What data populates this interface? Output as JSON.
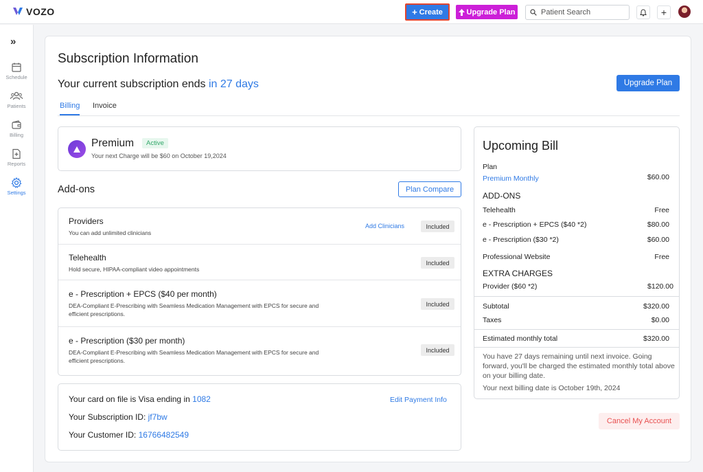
{
  "header": {
    "logo": "VOZO",
    "create_label": "Create",
    "upgrade_label": "Upgrade Plan",
    "search_placeholder": "Patient Search"
  },
  "sidebar": {
    "items": [
      {
        "label": "Schedule",
        "icon": "calendar-icon"
      },
      {
        "label": "Patients",
        "icon": "users-icon"
      },
      {
        "label": "Billing",
        "icon": "wallet-icon"
      },
      {
        "label": "Reports",
        "icon": "report-icon"
      },
      {
        "label": "Settings",
        "icon": "gear-icon"
      }
    ]
  },
  "page": {
    "title": "Subscription Information",
    "subscription_prefix": "Your current subscription ends",
    "subscription_days": "in 27 days",
    "upgrade_button": "Upgrade Plan",
    "tabs": [
      "Billing",
      "Invoice"
    ]
  },
  "plan": {
    "name": "Premium",
    "status": "Active",
    "next_charge": "Your next Charge will be $60 on October 19,2024"
  },
  "addons": {
    "title": "Add-ons",
    "compare_button": "Plan Compare",
    "items": [
      {
        "name": "Providers",
        "desc": "You can add unlimited clinicians",
        "action": "Add Clinicians",
        "badge": "Included"
      },
      {
        "name": "Telehealth",
        "desc": "Hold secure, HIPAA-compliant video appointments",
        "badge": "Included"
      },
      {
        "name": "e - Prescription + EPCS ($40 per month)",
        "desc": "DEA-Compliant E-Prescribing with Seamless Medication Management with EPCS for secure and efficient prescriptions.",
        "badge": "Included"
      },
      {
        "name": "e - Prescription ($30 per month)",
        "desc": "DEA-Compliant E-Prescribing with Seamless Medication Management with EPCS for secure and efficient prescriptions.",
        "badge": "Included"
      }
    ]
  },
  "payment": {
    "card_prefix": "Your card on file is Visa ending in",
    "card_last4": "1082",
    "edit_label": "Edit Payment Info",
    "subscription_prefix": "Your Subscription ID:",
    "subscription_id": "jf7bw",
    "customer_prefix": "Your Customer ID:",
    "customer_id": "16766482549"
  },
  "bill": {
    "title": "Upcoming Bill",
    "plan_label": "Plan",
    "plan_name": "Premium Monthly",
    "plan_amount": "$60.00",
    "addons_heading": "ADD-ONS",
    "addons": [
      {
        "label": "Telehealth",
        "amount": "Free"
      },
      {
        "label": "e - Prescription + EPCS ($40 *2)",
        "amount": "$80.00"
      },
      {
        "label": "e - Prescription ($30 *2)",
        "amount": "$60.00"
      },
      {
        "label": "Professional Website",
        "amount": "Free"
      }
    ],
    "extra_heading": "EXTRA CHARGES",
    "extra": {
      "label": "Provider ($60 *2)",
      "amount": "$120.00"
    },
    "subtotal_label": "Subtotal",
    "subtotal": "$320.00",
    "taxes_label": "Taxes",
    "taxes": "$0.00",
    "total_label": "Estimated monthly total",
    "total": "$320.00",
    "note": "You have 27 days remaining until next invoice. Going forward, you'll be charged the estimated monthly total above on your billing date.",
    "next_date": "Your next billing date is October 19th, 2024"
  },
  "cancel_label": "Cancel My Account",
  "colors": {
    "accent": "#2f7ae5",
    "upgrade": "#cc1fd8",
    "active": "#33a86a",
    "danger": "#e85050"
  }
}
